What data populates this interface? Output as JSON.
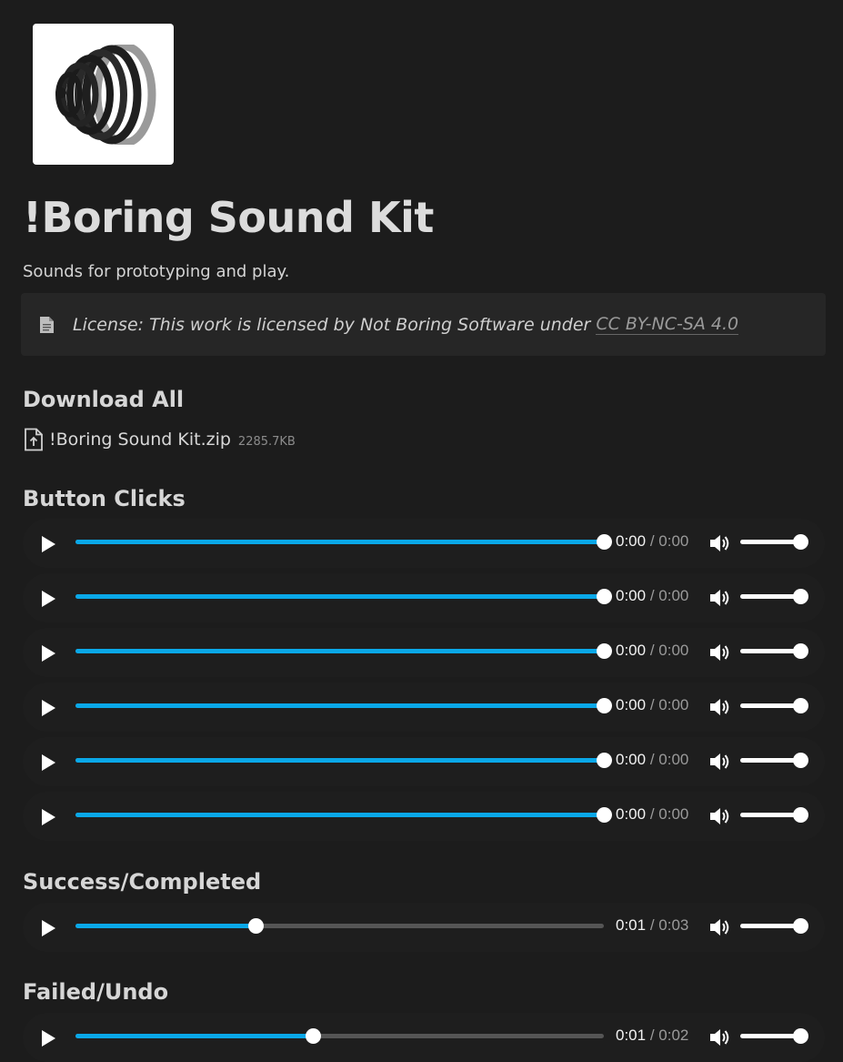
{
  "header": {
    "logo_icon": "boring-logo-icon",
    "title": "!Boring Sound Kit",
    "subtitle": "Sounds for prototyping and play."
  },
  "license": {
    "icon": "document-icon",
    "text": "License: This work is licensed by Not Boring Software under",
    "link_label": "CC BY-NC-SA 4.0"
  },
  "download": {
    "heading": "Download All",
    "icon": "file-upload-icon",
    "file_name": "!Boring Sound Kit.zip",
    "file_size": "2285.7KB"
  },
  "sections": [
    {
      "heading": "Button Clicks",
      "players": [
        {
          "current": "0:00",
          "duration": "0:00",
          "progress": 1.0,
          "volume": 1.0
        },
        {
          "current": "0:00",
          "duration": "0:00",
          "progress": 1.0,
          "volume": 1.0
        },
        {
          "current": "0:00",
          "duration": "0:00",
          "progress": 1.0,
          "volume": 1.0
        },
        {
          "current": "0:00",
          "duration": "0:00",
          "progress": 1.0,
          "volume": 1.0
        },
        {
          "current": "0:00",
          "duration": "0:00",
          "progress": 1.0,
          "volume": 1.0
        },
        {
          "current": "0:00",
          "duration": "0:00",
          "progress": 1.0,
          "volume": 1.0
        }
      ]
    },
    {
      "heading": "Success/Completed",
      "players": [
        {
          "current": "0:01",
          "duration": "0:03",
          "progress": 0.34,
          "volume": 1.0
        }
      ]
    },
    {
      "heading": "Failed/Undo",
      "players": [
        {
          "current": "0:01",
          "duration": "0:02",
          "progress": 0.45,
          "volume": 1.0
        }
      ]
    }
  ],
  "player_ui": {
    "time_separator": "/",
    "play_icon": "play-icon",
    "volume_icon": "volume-icon"
  },
  "colors": {
    "background": "#1c1c1c",
    "accent": "#0aa8e8",
    "track": "#555555"
  }
}
